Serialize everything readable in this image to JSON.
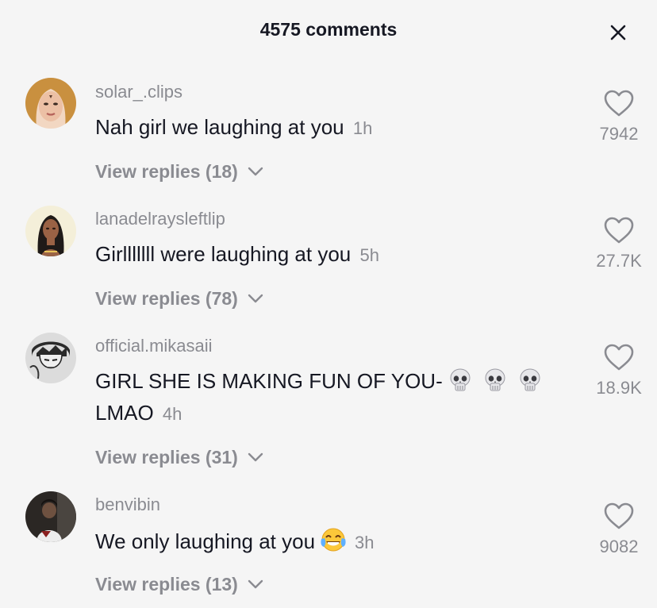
{
  "header": {
    "title": "4575 comments"
  },
  "comments": [
    {
      "username": "solar_.clips",
      "text": "Nah girl we laughing at you",
      "time": "1h",
      "likes": "7942",
      "replies": "View replies (18)"
    },
    {
      "username": "lanadelraysleftlip",
      "text": "Girlllllll were laughing at you",
      "time": "5h",
      "likes": "27.7K",
      "replies": "View replies (78)"
    },
    {
      "username": "official.mikasaii",
      "text": "GIRL SHE IS MAKING FUN OF YOU-",
      "text2": "LMAO",
      "time": "4h",
      "likes": "18.9K",
      "replies": "View replies (31)"
    },
    {
      "username": "benvibin",
      "text": "We only laughing at you",
      "time": "3h",
      "likes": "9082",
      "replies": "View replies (13)"
    }
  ],
  "icons": {
    "close": "close-icon",
    "like": "heart-icon",
    "expand": "chevron-down-icon",
    "skull": "skull-emoji",
    "laugh": "tears-of-joy-emoji"
  },
  "colors": {
    "background": "#f5f5f5",
    "primary_text": "#161823",
    "secondary_text": "#8a8b91"
  }
}
